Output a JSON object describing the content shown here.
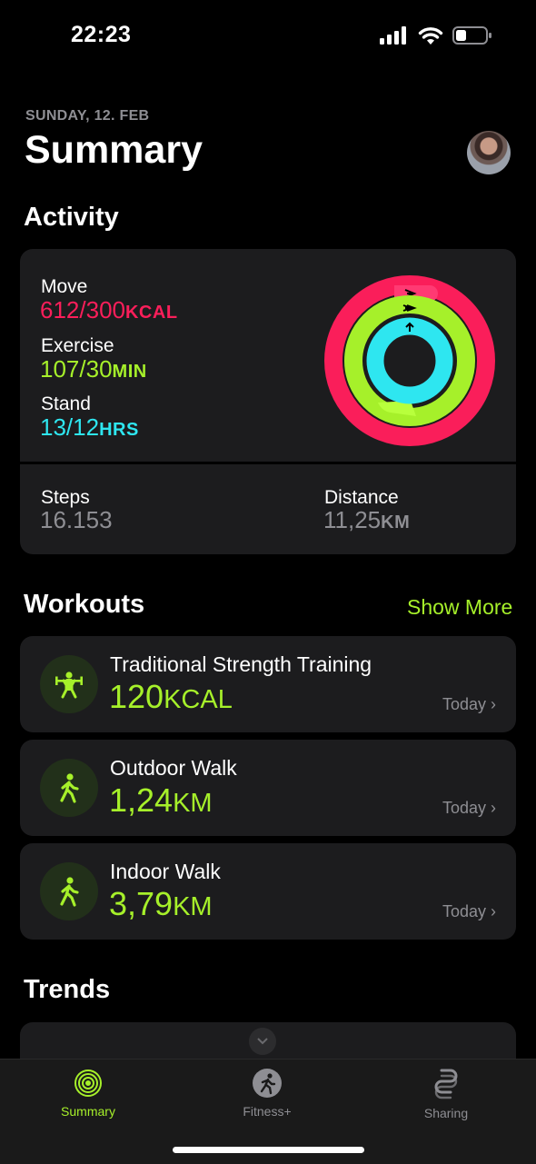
{
  "status_bar": {
    "time": "22:23",
    "icons": [
      "cellular-signal-icon",
      "wifi-icon",
      "battery-icon"
    ]
  },
  "header": {
    "date": "SUNDAY, 12. FEB",
    "title": "Summary",
    "avatar": "avatar-photo"
  },
  "activity": {
    "title": "Activity",
    "move": {
      "label": "Move",
      "value": "612/300",
      "unit": "KCAL",
      "progress": 2.04
    },
    "exercise": {
      "label": "Exercise",
      "value": "107/30",
      "unit": "MIN",
      "progress": 3.57
    },
    "stand": {
      "label": "Stand",
      "value": "13/12",
      "unit": "HRS",
      "progress": 1.08
    },
    "steps": {
      "label": "Steps",
      "value": "16.153"
    },
    "distance": {
      "label": "Distance",
      "value": "11,25",
      "unit": "KM"
    },
    "colors": {
      "move": "#fa1e5a",
      "exercise": "#a6f02a",
      "stand": "#2ee6f0"
    }
  },
  "workouts": {
    "title": "Workouts",
    "show_more": "Show More",
    "items": [
      {
        "name": "Traditional Strength Training",
        "value": "120",
        "unit": "KCAL",
        "date": "Today",
        "icon": "weightlifter-icon"
      },
      {
        "name": "Outdoor Walk",
        "value": "1,24",
        "unit": "KM",
        "date": "Today",
        "icon": "walking-figure-icon"
      },
      {
        "name": "Indoor Walk",
        "value": "3,79",
        "unit": "KM",
        "date": "Today",
        "icon": "walking-figure-icon"
      }
    ]
  },
  "trends": {
    "title": "Trends"
  },
  "tab_bar": {
    "tabs": [
      {
        "label": "Summary",
        "icon": "activity-rings-icon",
        "active": true
      },
      {
        "label": "Fitness+",
        "icon": "fitness-runner-icon",
        "active": false
      },
      {
        "label": "Sharing",
        "icon": "sharing-icon",
        "active": false
      }
    ]
  }
}
